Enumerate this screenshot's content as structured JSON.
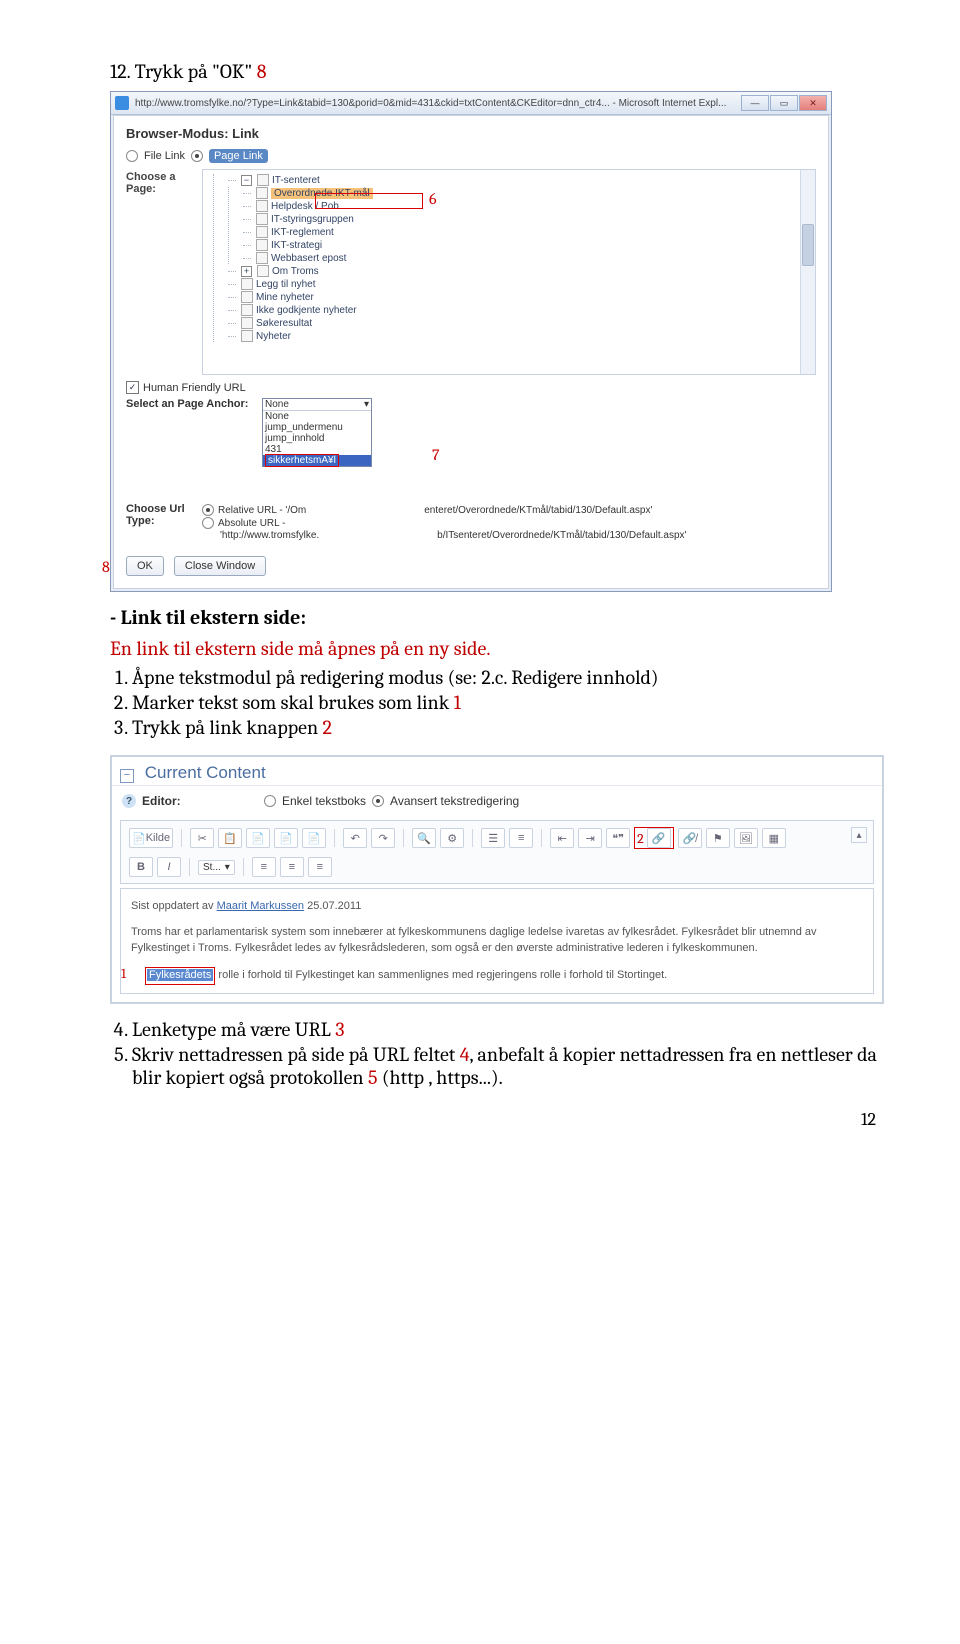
{
  "heading12": {
    "number": "12.",
    "text": "Trykk på \"OK\"",
    "anno": "8"
  },
  "screenshot1": {
    "title_url": "http://www.tromsfylke.no/?Type=Link&tabid=130&porid=0&mid=431&ckid=txtContent&CKEditor=dnn_ctr4... - Microsoft Internet Expl...",
    "modus_label": "Browser-Modus: Link",
    "file_link": "File Link",
    "page_link": "Page Link",
    "choose_page": "Choose a Page:",
    "tree": {
      "it_senteret": "IT-senteret",
      "overordnede": "Overordnede IKT-mål",
      "helpdesk": "Helpdesk / Pob",
      "styring": "IT-styringsgruppen",
      "reglement": "IKT-reglement",
      "strategi": "IKT-strategi",
      "epost": "Webbasert epost",
      "om_troms": "Om Troms",
      "legg_til": "Legg til nyhet",
      "mine": "Mine nyheter",
      "ikke_godkj": "Ikke godkjente nyheter",
      "sokeresultat": "Søkeresultat",
      "nyheter": "Nyheter"
    },
    "human_friendly": "Human Friendly URL",
    "select_anchor": "Select an Page Anchor:",
    "dropdown": {
      "sel": "None",
      "opts": [
        "None",
        "jump_undermenu",
        "jump_innhold",
        "431",
        "sikkerhetsmA¥l"
      ]
    },
    "choose_url_type": "Choose Url Type:",
    "relative": "Relative URL - '/Om",
    "relative_tail": "enteret/Overordnede/KTmål/tabid/130/Default.aspx'",
    "absolute": "Absolute URL -",
    "absolute_tail": "'http://www.tromsfylke.",
    "absolute_tail2": "b/ITsenteret/Overordnede/KTmål/tabid/130/Default.aspx'",
    "ok_btn": "OK",
    "close_btn": "Close Window",
    "anno6": "6",
    "anno7": "7",
    "anno8": "8"
  },
  "section_ext": {
    "title": "Link til ekstern side:",
    "intro": "En link til ekstern side må åpnes på en ny side.",
    "items": {
      "1a": "Åpne tekstmodul på redigering modus (se: ",
      "1b": "2.c. Redigere innhold",
      "1c": ")",
      "2a": "Marker tekst som skal brukes som link ",
      "2n": "1",
      "3a": "Trykk på link knappen ",
      "3n": "2"
    }
  },
  "editor": {
    "head": "Current Content",
    "editor_label": "Editor:",
    "opt_simple": "Enkel tekstboks",
    "opt_adv": "Avansert tekstredigering",
    "kilde": "Kilde",
    "font_sel": "St...",
    "b": "B",
    "i": "I",
    "anno2": "2",
    "updated_a": "Sist oppdatert av ",
    "updated_b": "Maarit Markussen",
    "updated_c": " 25.07.2011",
    "para1": "Troms har et parlamentarisk system som innebærer at fylkeskommunens daglige ledelse ivaretas av fylkesrådet. Fylkesrådet blir utnemnd av Fylkestinget i Troms. Fylkesrådet ledes av fylkesrådslederen, som også er den øverste administrative lederen i fylkeskommunen.",
    "para2_hl": "Fylkesrådets",
    "para2_rest": " rolle i forhold til Fylkestinget kan sammenlignes med regjeringens rolle i forhold til Stortinget.",
    "anno1": "1"
  },
  "after_editor": {
    "items": {
      "4a": "Lenketype må være URL ",
      "4n": "3",
      "5a": "Skriv nettadressen på side på URL feltet ",
      "5n": "4",
      "5b": ", anbefalt å kopier nettadressen fra en nettleser da blir kopiert også protokollen ",
      "5n2": "5",
      "5c": " (http , https...)."
    }
  },
  "page_number": "12"
}
